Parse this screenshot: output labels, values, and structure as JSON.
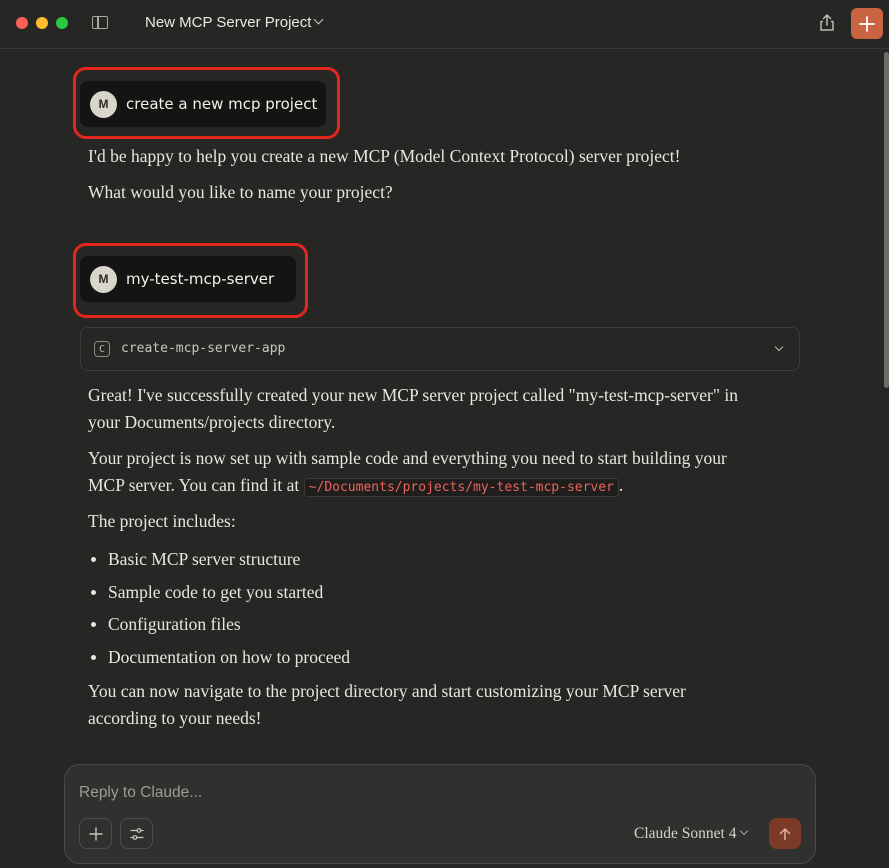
{
  "window": {
    "title": "New MCP Server Project"
  },
  "icons": {
    "sidebar_toggle": "sidebar-toggle-icon",
    "share": "share-icon",
    "new_chat": "plus-icon",
    "tool": "terminal-icon",
    "attach": "plus-icon",
    "tools_settings": "sliders-icon",
    "send": "arrow-up-icon"
  },
  "colors": {
    "accent": "#c96442",
    "highlight_box": "#e3271f",
    "send_button": "#7a3a26",
    "inline_code": "#e9645c",
    "background": "#262624"
  },
  "conversation": {
    "user_message_1": {
      "avatar": "M",
      "text": "create a new mcp project"
    },
    "assistant_reply_1": {
      "para_1": "I'd be happy to help you create a new MCP (Model Context Protocol) server project!",
      "para_2": "What would you like to name your project?"
    },
    "user_message_2": {
      "avatar": "M",
      "text": "my-test-mcp-server"
    },
    "tool_call": {
      "icon_letter": "C",
      "name": "create-mcp-server-app"
    },
    "assistant_reply_2": {
      "para_1_line_1": "Great! I've successfully created your new MCP server project called \"my-test-mcp-server\" in",
      "para_1_line_2": "your Documents/projects directory.",
      "para_2_line_1": "Your project is now set up with sample code and everything you need to start building your",
      "para_2_line_2_prefix": "MCP server. You can find it at",
      "para_2_code": "~/Documents/projects/my-test-mcp-server",
      "para_2_line_2_suffix": ".",
      "para_3": "The project includes:",
      "list": [
        "Basic MCP server structure",
        "Sample code to get you started",
        "Configuration files",
        "Documentation on how to proceed"
      ],
      "para_4_line_1": "You can now navigate to the project directory and start customizing your MCP server",
      "para_4_line_2": "according to your needs!"
    }
  },
  "composer": {
    "placeholder": "Reply to Claude...",
    "value": "",
    "model": "Claude Sonnet 4"
  }
}
